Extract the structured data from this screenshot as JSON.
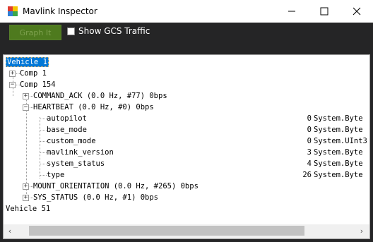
{
  "window": {
    "title": "Mavlink Inspector"
  },
  "toolbar": {
    "graph_label": "Graph It",
    "show_gcs_label": "Show GCS Traffic"
  },
  "tree": {
    "vehicle1": "Vehicle 1",
    "comp1": "Comp 1",
    "comp154": "Comp 154",
    "command_ack": "COMMAND_ACK (0.0 Hz, #77) 0bps",
    "heartbeat": "HEARTBEAT (0.0 Hz, #0) 0bps",
    "fields": [
      {
        "name": "autopilot",
        "value": "0",
        "type": "System.Byte"
      },
      {
        "name": "base_mode",
        "value": "0",
        "type": "System.Byte"
      },
      {
        "name": "custom_mode",
        "value": "0",
        "type": "System.UInt3"
      },
      {
        "name": "mavlink_version",
        "value": "3",
        "type": "System.Byte"
      },
      {
        "name": "system_status",
        "value": "4",
        "type": "System.Byte"
      },
      {
        "name": "type",
        "value": "26",
        "type": "System.Byte"
      }
    ],
    "mount_orientation": "MOUNT_ORIENTATION (0.0 Hz, #265) 0bps",
    "sys_status": "SYS_STATUS (0.0 Hz, #1) 0bps",
    "vehicle51": "Vehicle 51"
  }
}
